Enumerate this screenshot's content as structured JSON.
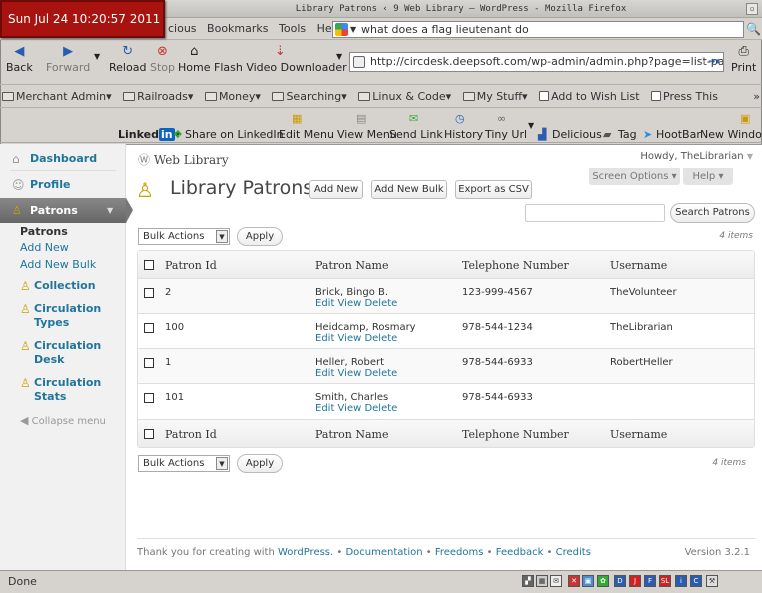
{
  "clock": "Sun Jul 24 10:20:57 2011",
  "window": {
    "title": "Library Patrons ‹ 9 Web Library — WordPress - Mozilla Firefox"
  },
  "menubar": {
    "items": [
      "cious",
      "Bookmarks",
      "Tools",
      "Help"
    ]
  },
  "search": {
    "value": "what does a flag lieutenant do"
  },
  "nav": {
    "back": "Back",
    "forward": "Forward",
    "reload": "Reload",
    "stop": "Stop",
    "home": "Home",
    "flash": "Flash Video Downloader",
    "url": "http://circdesk.deepsoft.com/wp-admin/admin.php?page=list-patro",
    "print": "Print"
  },
  "bookmarks": [
    "Merchant Admin",
    "Railroads",
    "Money",
    "Searching",
    "Linux & Code",
    "My Stuff",
    "Add to Wish List",
    "Press This"
  ],
  "toolbar2": {
    "linkedin": "Linked",
    "items": [
      "Share on LinkedIn",
      "Edit Menu",
      "View Menu",
      "Send Link",
      "History",
      "Tiny Url",
      "Delicious",
      "Tag",
      "HootBar",
      "New Window"
    ]
  },
  "sidebar": {
    "dashboard": "Dashboard",
    "profile": "Profile",
    "patrons": "Patrons",
    "sub": [
      "Patrons",
      "Add New",
      "Add New Bulk"
    ],
    "collection": "Collection",
    "circ_types": "Circulation Types",
    "circ_desk": "Circulation Desk",
    "circ_stats": "Circulation Stats",
    "collapse": "Collapse menu"
  },
  "header": {
    "site": "Web Library",
    "howdy": "Howdy, TheLibrarian",
    "screen_options": "Screen Options",
    "help": "Help"
  },
  "main": {
    "title": "Library Patrons",
    "add_new": "Add New",
    "add_new_bulk": "Add New Bulk",
    "export": "Export as CSV",
    "search_button": "Search Patrons",
    "bulk_actions": "Bulk Actions",
    "apply": "Apply",
    "count": "4 items"
  },
  "table": {
    "columns": [
      "Patron Id",
      "Patron Name",
      "Telephone Number",
      "Username"
    ],
    "row_actions": "Edit View Delete",
    "rows": [
      {
        "id": "2",
        "name": "Brick, Bingo B.",
        "phone": "123-999-4567",
        "user": "TheVolunteer"
      },
      {
        "id": "100",
        "name": "Heidcamp, Rosmary",
        "phone": "978-544-1234",
        "user": "TheLibrarian"
      },
      {
        "id": "1",
        "name": "Heller, Robert",
        "phone": "978-544-6933",
        "user": "RobertHeller"
      },
      {
        "id": "101",
        "name": "Smith, Charles",
        "phone": "978-544-6933",
        "user": ""
      }
    ]
  },
  "footer": {
    "thanks": "Thank you for creating with",
    "wordpress": "WordPress.",
    "links": [
      "Documentation",
      "Freedoms",
      "Feedback",
      "Credits"
    ],
    "version": "Version 3.2.1"
  },
  "status": "Done"
}
